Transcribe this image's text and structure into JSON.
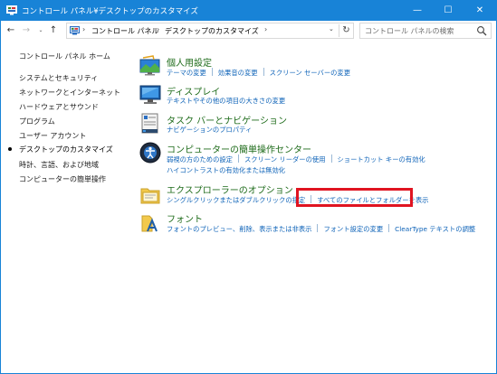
{
  "window": {
    "title": "コントロール パネル¥デスクトップのカスタマイズ",
    "minimize_symbol": "—",
    "maximize_symbol": "☐",
    "close_symbol": "✕"
  },
  "nav": {
    "back_symbol": "←",
    "forward_symbol": "→",
    "recent_symbol": "⌄",
    "up_symbol": "↑",
    "crumb_sep": "›",
    "breadcrumbs": [
      "コントロール パネル",
      "デスクトップのカスタマイズ"
    ],
    "dropdown_symbol": "⌄",
    "refresh_symbol": "↻",
    "search_placeholder": "コントロール パネルの検索"
  },
  "sidebar": {
    "home": "コントロール パネル ホーム",
    "items": [
      "システムとセキュリティ",
      "ネットワークとインターネット",
      "ハードウェアとサウンド",
      "プログラム",
      "ユーザー アカウント",
      "デスクトップのカスタマイズ",
      "時計、言語、および地域",
      "コンピューターの簡単操作"
    ],
    "active_index": 5
  },
  "categories": [
    {
      "icon": "personalization-icon",
      "title": "個人用設定",
      "links": [
        [
          "テーマの変更",
          "効果音の変更",
          "スクリーン セーバーの変更"
        ]
      ]
    },
    {
      "icon": "display-icon",
      "title": "ディスプレイ",
      "links": [
        [
          "テキストやその他の項目の大きさの変更"
        ]
      ]
    },
    {
      "icon": "taskbar-icon",
      "title": "タスク バーとナビゲーション",
      "links": [
        [
          "ナビゲーションのプロパティ"
        ]
      ]
    },
    {
      "icon": "ease-of-access-icon",
      "title": "コンピューターの簡単操作センター",
      "links": [
        [
          "弱視の方のための設定",
          "スクリーン リーダーの使用",
          "ショートカット キーの有効化"
        ],
        [
          "ハイコントラストの有効化または無効化"
        ]
      ]
    },
    {
      "icon": "explorer-options-icon",
      "title": "エクスプローラーのオプション",
      "links": [
        [
          "シングルクリックまたはダブルクリックの指定",
          "すべてのファイルとフォルダーを表示"
        ]
      ]
    },
    {
      "icon": "fonts-icon",
      "title": "フォント",
      "links": [
        [
          "フォントのプレビュー、削除、表示または非表示",
          "フォント設定の変更",
          "ClearType テキストの調整"
        ]
      ]
    }
  ],
  "colors": {
    "accent": "#1883d7",
    "category_title": "#1e6b1a",
    "link": "#0e63b8",
    "highlight": "#e01421"
  }
}
